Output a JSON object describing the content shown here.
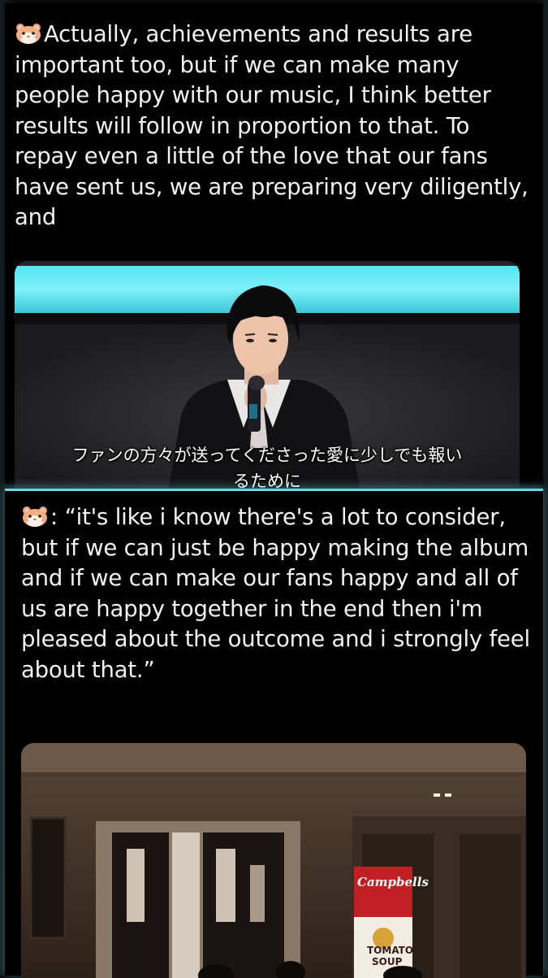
{
  "tweet1": {
    "emoji": "hamster-face-icon",
    "text": "Actually, achievements and results are important too, but if we can make many people happy with our music, I think better results will follow in proportion to that. To repay even a little of the love that our fans have sent us, we are preparing very diligently, and",
    "media": {
      "subtitle_line1": "ファンの方々が送ってくださった愛に少しでも報い",
      "subtitle_line2": "るために"
    }
  },
  "tweet2": {
    "emoji": "hamster-face-icon",
    "text": ": “it's like i know there's a lot to consider, but if we can just be happy making the album and if we can make our fans happy and all of us are happy together in the end then i'm pleased about the outcome and i strongly feel about that.”",
    "media": {
      "poster_brand": "Campbells",
      "poster_line1": "TOMATO",
      "poster_line2": "SOUP"
    }
  },
  "colors": {
    "background": "#000000",
    "text": "#f2f2f2",
    "divider_accent": "#6fd3e0"
  }
}
